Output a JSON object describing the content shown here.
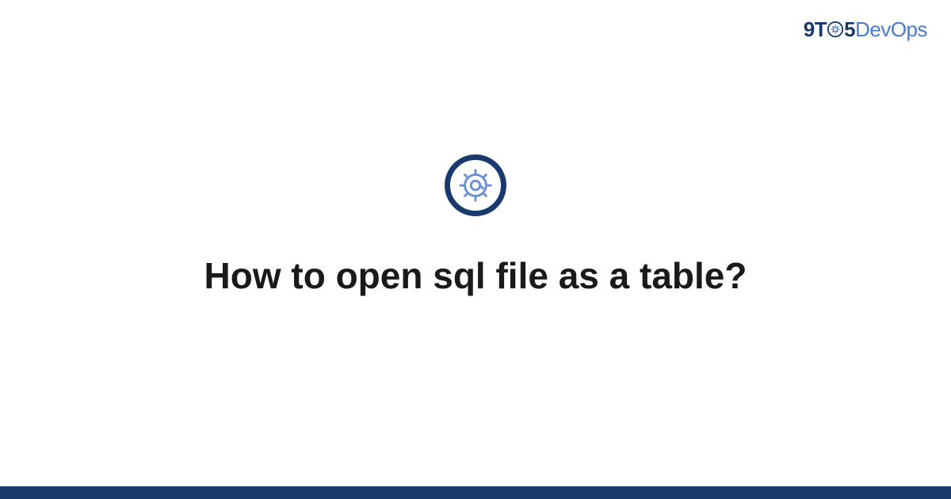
{
  "logo": {
    "part1": "9T",
    "part2": "5",
    "part3": "DevOps"
  },
  "title": "How to open sql file as a table?",
  "icon": {
    "name": "gear-icon"
  },
  "colors": {
    "primary": "#1a3a6e",
    "accent": "#4a7bc8",
    "gear_stroke": "#6b8fd4"
  }
}
